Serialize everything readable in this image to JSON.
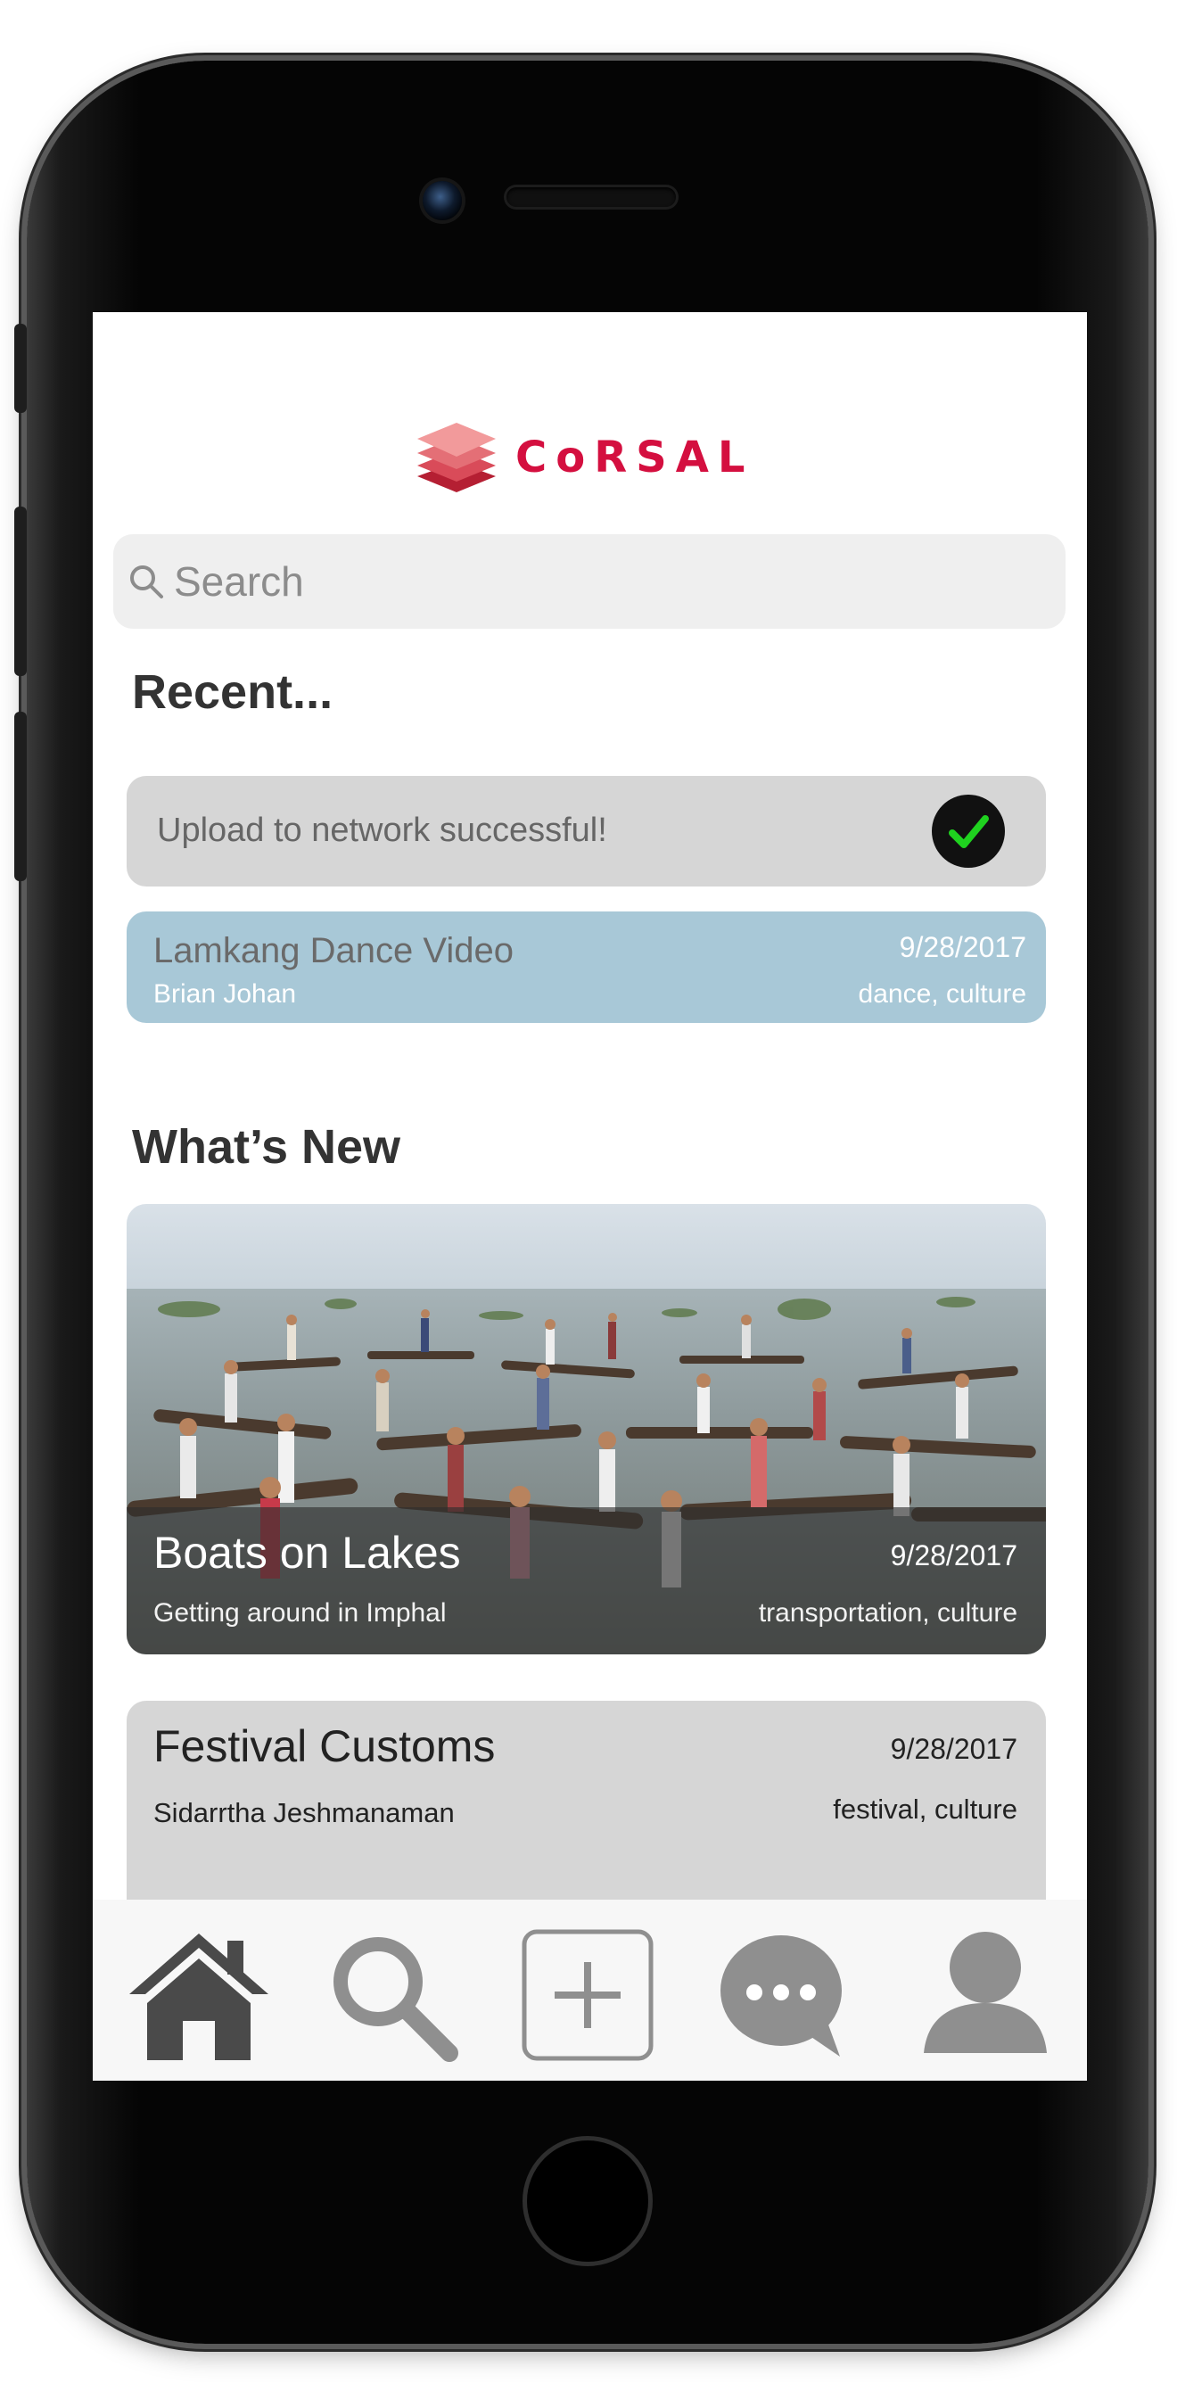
{
  "app": {
    "logo_text": "CoRSAL",
    "logo_icon": "stacked-layers-icon",
    "brand_color": "#d40f3f"
  },
  "search": {
    "placeholder": "Search",
    "icon": "search-icon"
  },
  "recent": {
    "title": "Recent...",
    "toast": {
      "message": "Upload to network successful!",
      "icon": "checkmark-icon",
      "check_color": "#1fd21f"
    },
    "items": [
      {
        "title": "Lamkang Dance Video",
        "author": "Brian Johan",
        "date": "9/28/2017",
        "tags": "dance, culture",
        "color": "#a8c8d7"
      }
    ]
  },
  "whats_new": {
    "title": "What’s New",
    "items": [
      {
        "title": "Boats on Lakes",
        "subtitle": "Getting around in Imphal",
        "date": "9/28/2017",
        "tags": "transportation, culture",
        "image": "boats-on-lake-photo"
      },
      {
        "title": "Festival Customs",
        "subtitle": "Sidarrtha Jeshmanaman",
        "date": "9/28/2017",
        "tags": "festival, culture"
      }
    ]
  },
  "tabbar": {
    "tabs": [
      {
        "name": "home",
        "icon": "home-icon",
        "active": true
      },
      {
        "name": "search",
        "icon": "search-icon"
      },
      {
        "name": "add",
        "icon": "plus-icon"
      },
      {
        "name": "messages",
        "icon": "chat-bubble-icon"
      },
      {
        "name": "profile",
        "icon": "person-icon"
      }
    ]
  }
}
